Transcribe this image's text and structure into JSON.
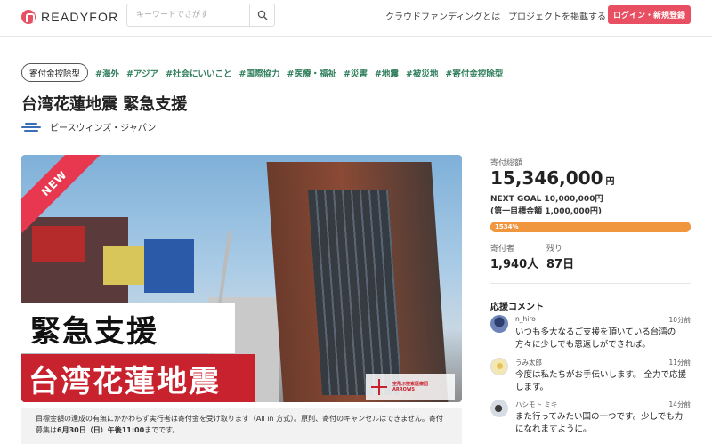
{
  "header": {
    "logo_text": "READYFOR",
    "search_placeholder": "キーワードでさがす",
    "nav_crowdfunding": "クラウドファンディングとは",
    "nav_post": "プロジェクトを掲載する",
    "login_label": "ログイン・新規登録"
  },
  "project": {
    "type_badge": "寄付金控除型",
    "tags": [
      "#海外",
      "#アジア",
      "#社会にいいこと",
      "#国際協力",
      "#医療・福祉",
      "#災害",
      "#地震",
      "#被災地",
      "#寄付金控除型"
    ],
    "title": "台湾花蓮地震 緊急支援",
    "organization": "ピースウィンズ・ジャパン"
  },
  "image": {
    "ribbon": "NEW",
    "banner_top": "緊急支援",
    "banner_bottom": "台湾花蓮地震",
    "partner_line1": "空飛ぶ捜索医療団",
    "partner_line2": "ARROWS"
  },
  "notice": {
    "text_normal": "目標金額の達成の有無にかかわらず実行者は寄付金を受け取ります（All in 方式）。原則、寄付のキャンセルはできません。寄付募集は",
    "text_bold": "6月30日（日）午後11:00",
    "text_end": "までです。"
  },
  "stats": {
    "total_label": "寄付総額",
    "total_amount": "15,346,000",
    "currency": "円",
    "next_goal": "NEXT GOAL 10,000,000円",
    "first_goal": "(第一目標金額 1,000,000円)",
    "progress_text": "1534%",
    "progress_percent": 100,
    "supporters_label": "寄付者",
    "supporters": "1,940人",
    "remain_label": "残り",
    "remain": "87日"
  },
  "comments": {
    "title": "応援コメント",
    "items": [
      {
        "name": "n_hiro",
        "time": "10分前",
        "text": "いつも多大なるご支援を頂いている台湾の方々に少しでも恩返しができれば。"
      },
      {
        "name": "うみ太郎",
        "time": "11分前",
        "text": "今度は私たちがお手伝いします。 全力で応援します。"
      },
      {
        "name": "ハシモト ミキ",
        "time": "14分前",
        "text": "また行ってみたい国の一つです。少しでも力になれますように。"
      }
    ]
  },
  "colors": {
    "brand": "#e84f62",
    "tag_green": "#2e7d5b",
    "progress": "#f0963e"
  }
}
